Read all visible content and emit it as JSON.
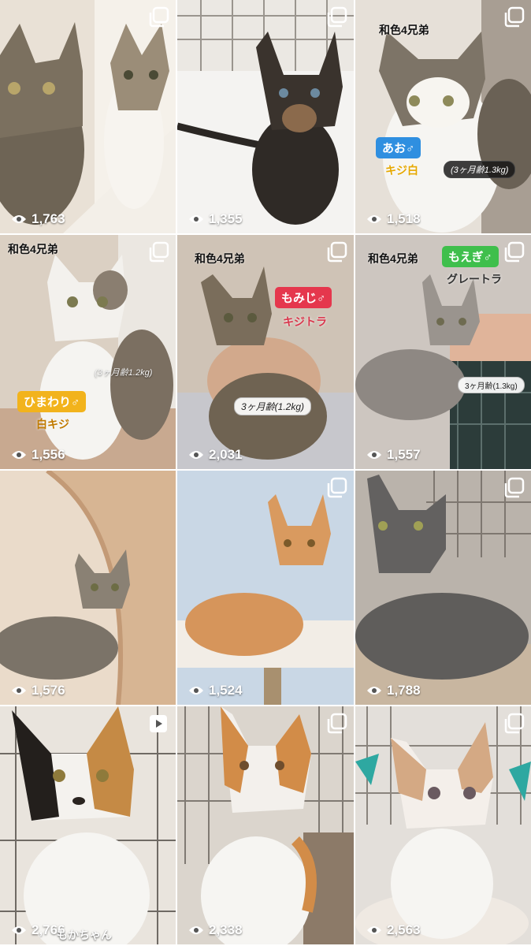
{
  "grid": {
    "tiles": [
      {
        "views": "1,763",
        "type": "multi",
        "bg": "#ddd3c4"
      },
      {
        "views": "1,355",
        "type": "multi",
        "bg": "#e8e4de"
      },
      {
        "views": "1,518",
        "type": "multi",
        "bg": "#e3ddd5",
        "caption": "和色4兄弟",
        "tag": "あお♂",
        "tag_color": "#2f8fe0",
        "pattern": "キジ白",
        "pattern_color": "#e6a800",
        "age": "(3ヶ月齢1.3kg)"
      },
      {
        "views": "1,556",
        "type": "multi",
        "bg": "#d9cdbf",
        "caption": "和色4兄弟",
        "tag": "ひまわり♂",
        "tag_color": "#f2b31c",
        "pattern": "白キジ",
        "pattern_color": "#c07a00",
        "age": "(3ヶ月齢1.2kg)"
      },
      {
        "views": "2,031",
        "type": "multi",
        "bg": "#cbbfb2",
        "caption": "和色4兄弟",
        "tag": "もみじ♂",
        "tag_color": "#e5374d",
        "pattern": "キジトラ",
        "pattern_color": "#d9374d",
        "age": "3ヶ月齢(1.2kg)"
      },
      {
        "views": "1,557",
        "type": "multi",
        "bg": "#c9c2bb",
        "caption": "和色4兄弟",
        "tag": "もえぎ♂",
        "tag_color": "#3fbf4c",
        "pattern": "グレートラ",
        "pattern_color": "#333333",
        "age": "3ヶ月齢(1.3kg)"
      },
      {
        "views": "1,576",
        "type": "none",
        "bg": "#e6d6c6"
      },
      {
        "views": "1,524",
        "type": "multi",
        "bg": "#c9d6e3"
      },
      {
        "views": "1,788",
        "type": "multi",
        "bg": "#b9b2ac"
      },
      {
        "views": "2,766",
        "type": "video",
        "bg": "#e8e3dc",
        "name": "もかちゃん"
      },
      {
        "views": "2,338",
        "type": "multi",
        "bg": "#dcd6cf"
      },
      {
        "views": "2,563",
        "type": "multi",
        "bg": "#e2ddd8"
      }
    ]
  },
  "icons": {
    "multi": "multi-photo-icon",
    "video": "play-icon",
    "views": "eye-icon"
  }
}
